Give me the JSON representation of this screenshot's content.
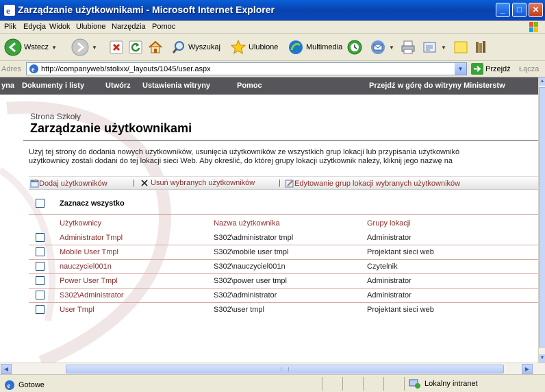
{
  "window": {
    "title": "Zarządzanie użytkownikami - Microsoft Internet Explorer",
    "buttons": [
      "_",
      "□",
      "✕"
    ]
  },
  "menu": [
    "Plik",
    "Edycja",
    "Widok",
    "Ulubione",
    "Narzędzia",
    "Pomoc"
  ],
  "toolbar": {
    "back_label": "Wstecz",
    "search_label": "Wyszukaj",
    "favorites_label": "Ulubione",
    "media_label": "Multimedia"
  },
  "address": {
    "label": "Adres",
    "url": "http://companyweb/stolixx/_layouts/1045/user.aspx",
    "go_label": "Przejdź",
    "links_label": "Łącza"
  },
  "topnav": {
    "home_fragment": "yna",
    "items": [
      "Dokumenty i listy",
      "Utwórz",
      "Ustawienia witryny",
      "Pomoc"
    ],
    "up_link": "Przejdź w górę do witryny Ministerstw"
  },
  "page": {
    "site_name": "Strona Szkoły",
    "title": "Zarządzanie użytkownikami",
    "desc_line1": "Użyj tej strony do dodania nowych użytkowników, usunięcia użytkowników ze wszystkich grup lokacji lub przypisania użytkownikó",
    "desc_line2": "użytkownicy zostali dodani do tej lokacji sieci Web. Aby określić, do której grupy lokacji użytkownik należy, kliknij jego nazwę na"
  },
  "actions": {
    "add": "Dodaj użytkowników",
    "remove": "Usuń wybranych użytkowników",
    "edit": "Edytowanie grup lokacji wybranych użytkowników",
    "separator": "|"
  },
  "table": {
    "select_all": "Zaznacz wszystko",
    "columns": [
      "Użytkownicy",
      "Nazwa użytkownika",
      "Grupy lokacji"
    ],
    "rows": [
      {
        "user": "Administrator Tmpl",
        "login": "S302\\administrator tmpl",
        "group": "Administrator"
      },
      {
        "user": "Mobile User Tmpl",
        "login": "S302\\mobile user tmpl",
        "group": "Projektant sieci web"
      },
      {
        "user": "nauczyciel001n",
        "login": "S302\\nauczyciel001n",
        "group": "Czytelnik"
      },
      {
        "user": "Power User Tmpl",
        "login": "S302\\power user tmpl",
        "group": "Administrator"
      },
      {
        "user": "S302\\Administrator",
        "login": "S302\\administrator",
        "group": "Administrator"
      },
      {
        "user": "User Tmpl",
        "login": "S302\\user tmpl",
        "group": "Projektant sieci web"
      }
    ]
  },
  "status": {
    "text": "Gotowe",
    "zone": "Lokalny intranet"
  },
  "colors": {
    "titlebar": "#0a5fd8",
    "topnav": "#55555a",
    "link_red": "#8a2f2a"
  }
}
